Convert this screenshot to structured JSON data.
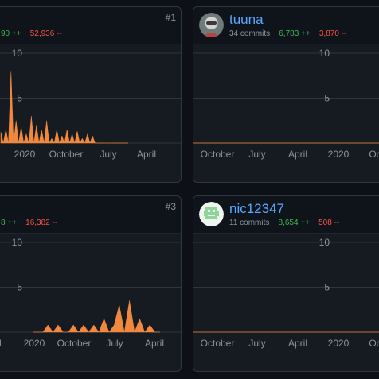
{
  "cards": [
    {
      "rank": "#1",
      "stats": {
        "commits_partial": "",
        "additions": "90 ++",
        "deletions": "52,936 --"
      },
      "y_ticks": [
        "10",
        "5"
      ],
      "x_ticks": [
        "2020",
        "October",
        "July",
        "April"
      ]
    },
    {
      "user": "tuuna",
      "stats": {
        "commits": "34 commits",
        "additions": "6,783 ++",
        "deletions": "3,870 --"
      },
      "y_ticks": [
        "10",
        "5"
      ],
      "x_ticks": [
        "October",
        "July",
        "April",
        "2020",
        "Octo"
      ]
    },
    {
      "rank": "#3",
      "stats": {
        "additions": "8 ++",
        "deletions": "16,382 --"
      },
      "y_ticks": [
        "10",
        "5"
      ],
      "x_ticks": [
        "il",
        "2020",
        "October",
        "July",
        "April"
      ]
    },
    {
      "user": "nic12347",
      "stats": {
        "commits": "11 commits",
        "additions": "8,654 ++",
        "deletions": "508 --"
      },
      "y_ticks": [
        "10",
        "5"
      ],
      "x_ticks": [
        "October",
        "July",
        "April",
        "2020",
        "Octo"
      ]
    }
  ],
  "chart_data": [
    {
      "type": "area",
      "ylim": [
        0,
        10
      ],
      "color": "#f0883e",
      "x": [
        0.0,
        0.02,
        0.04,
        0.06,
        0.08,
        0.1,
        0.12,
        0.14,
        0.16,
        0.18,
        0.2,
        0.22,
        0.24,
        0.26,
        0.28,
        0.3,
        0.32,
        0.34,
        0.36,
        0.38,
        0.4,
        0.42,
        0.44,
        0.46,
        0.48,
        0.5,
        0.52,
        0.54,
        0.56,
        0.58,
        0.6,
        0.62,
        0.64,
        0.66,
        0.68,
        0.7,
        0.72,
        0.74,
        0.76,
        0.78,
        0.8,
        0.82,
        0.84,
        0.86,
        0.88,
        0.9,
        0.92,
        0.94,
        0.96,
        0.98,
        1.0
      ],
      "values": [
        1.2,
        0,
        1.5,
        0,
        8,
        0,
        2.5,
        0,
        1.8,
        0,
        1,
        0,
        3,
        0,
        2,
        0,
        1.5,
        0,
        2.5,
        0,
        0.5,
        0,
        1.5,
        0,
        0.8,
        0,
        1.5,
        0,
        1,
        0,
        1.3,
        0,
        0.5,
        0,
        1,
        0,
        0.8,
        0,
        0,
        0,
        0,
        0,
        0,
        0,
        0,
        0,
        0,
        0,
        0,
        0,
        0
      ]
    },
    {
      "type": "area",
      "ylim": [
        0,
        10
      ],
      "color": "#f0883e",
      "x": [
        0,
        1
      ],
      "values": [
        0,
        0
      ]
    },
    {
      "type": "area",
      "ylim": [
        0,
        10
      ],
      "color": "#f0883e",
      "x": [
        0.0,
        0.04,
        0.08,
        0.12,
        0.16,
        0.2,
        0.24,
        0.28,
        0.32,
        0.36,
        0.4,
        0.44,
        0.48,
        0.52,
        0.56,
        0.6,
        0.64,
        0.68,
        0.72,
        0.76,
        0.8,
        0.84,
        0.88,
        0.92,
        0.96,
        1.0
      ],
      "values": [
        0,
        0,
        0,
        0.8,
        0,
        0.8,
        0,
        0,
        0.8,
        0,
        0.8,
        0,
        0.8,
        0,
        1.5,
        0,
        0.8,
        3,
        0,
        3.5,
        0,
        1.5,
        0,
        0.8,
        0,
        0
      ]
    },
    {
      "type": "area",
      "ylim": [
        0,
        10
      ],
      "color": "#f0883e",
      "x": [
        0,
        1
      ],
      "values": [
        0,
        0
      ]
    }
  ]
}
